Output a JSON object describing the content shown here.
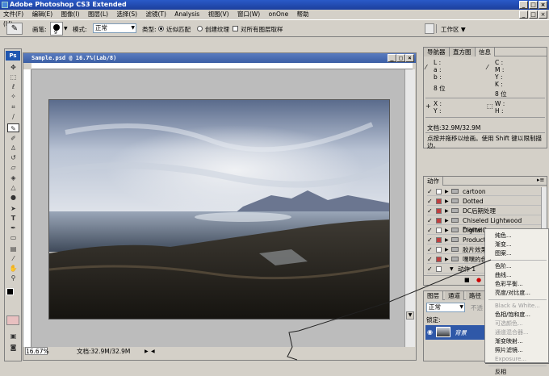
{
  "titlebar": {
    "title": "Adobe Photoshop CS3 Extended"
  },
  "menu": [
    "文件(F)",
    "编辑(E)",
    "图像(I)",
    "图层(L)",
    "选择(S)",
    "滤镜(T)",
    "Analysis",
    "视图(V)",
    "窗口(W)",
    "onOne",
    "帮助(H)"
  ],
  "options": {
    "brush_label": "画笔:",
    "brush_size": "9",
    "mode_label": "模式:",
    "mode_value": "正常",
    "type_label": "类型:",
    "type_opt1": "近似匹配",
    "type_opt2": "创建纹理",
    "sample_all": "对所有图层取样",
    "workspace": "工作区 ▼"
  },
  "document": {
    "title": "Sample.psd @ 16.7%(Lab/8)",
    "zoom": "16.67%",
    "doc_info": "文档:32.9M/32.9M"
  },
  "info_panel": {
    "tabs": [
      "导航器",
      "直方图",
      "信息"
    ],
    "lab": {
      "l": "L :",
      "a": "a :",
      "b": "b :",
      "bits": "8 位"
    },
    "cmyk": {
      "c": "C :",
      "m": "M :",
      "y": "Y :",
      "k": "K :",
      "bits": "8 位"
    },
    "xy": {
      "x": "X :",
      "y": "Y :",
      "w": "W :",
      "h": "H :"
    },
    "doc_line": "文档:32.9M/32.9M",
    "hint": "点按并拖移以绘画。使用 Shift 键以限制描边。"
  },
  "actions_panel": {
    "tab": "动作",
    "items": [
      {
        "label": "cartoon",
        "red": false
      },
      {
        "label": "Dotted",
        "red": true
      },
      {
        "label": "DC后期处理",
        "red": true
      },
      {
        "label": "Chiseled Lightwood Frame",
        "red": true
      },
      {
        "label": "DigitalCa",
        "red": false
      },
      {
        "label": "Productio",
        "red": true
      },
      {
        "label": "胶片效果",
        "red": false
      },
      {
        "label": "嘿嘿的色",
        "red": true
      },
      {
        "label": "动作 1",
        "red": false
      }
    ]
  },
  "layers_panel": {
    "tabs": [
      "图层",
      "通道",
      "路径"
    ],
    "mode": "正常",
    "opacity_label": "不透",
    "lock_label": "锁定:",
    "layer_name": "背景"
  },
  "context_menu": {
    "items": [
      {
        "label": "纯色...",
        "disabled": false
      },
      {
        "label": "渐变...",
        "disabled": false
      },
      {
        "label": "图案...",
        "disabled": false
      },
      {
        "sep": true
      },
      {
        "label": "色阶...",
        "disabled": false
      },
      {
        "label": "曲线...",
        "disabled": false
      },
      {
        "label": "色彩平衡...",
        "disabled": false
      },
      {
        "label": "亮度/对比度...",
        "disabled": false
      },
      {
        "sep": true
      },
      {
        "label": "Black & White...",
        "disabled": true
      },
      {
        "label": "色相/饱和度...",
        "disabled": false
      },
      {
        "label": "可选颜色...",
        "disabled": true
      },
      {
        "label": "通道混合器...",
        "disabled": true
      },
      {
        "label": "渐变映射...",
        "disabled": false
      },
      {
        "label": "照片滤镜...",
        "disabled": false
      },
      {
        "label": "Exposure...",
        "disabled": true
      },
      {
        "sep": true
      },
      {
        "label": "反相",
        "disabled": false
      }
    ]
  }
}
